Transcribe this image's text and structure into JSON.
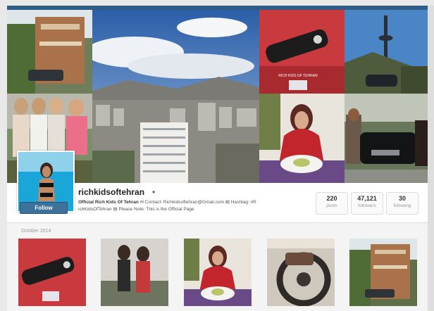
{
  "profile": {
    "username": "richkidsoftehran",
    "caret": "•",
    "bio_bold": "Official Rich Kids Of Tehran",
    "bio_rest": " ✉ Contact: Richkidsoftehran@Gmail.com ▤ Hashtag: #R ichKidsOfTehran ▤ Please Note: This is the Official Page",
    "follow_label": "Follow"
  },
  "stats": [
    {
      "value": "220",
      "label": "posts"
    },
    {
      "value": "47,121",
      "label": "followers"
    },
    {
      "value": "30",
      "label": "following"
    }
  ],
  "feed": {
    "month_label": "October 2014"
  },
  "images": {
    "key_card_text": "RICH KIDS OF TEHRAN"
  },
  "colors": {
    "brand_blue": "#3f729b",
    "top_bar": "#2f5d86"
  }
}
